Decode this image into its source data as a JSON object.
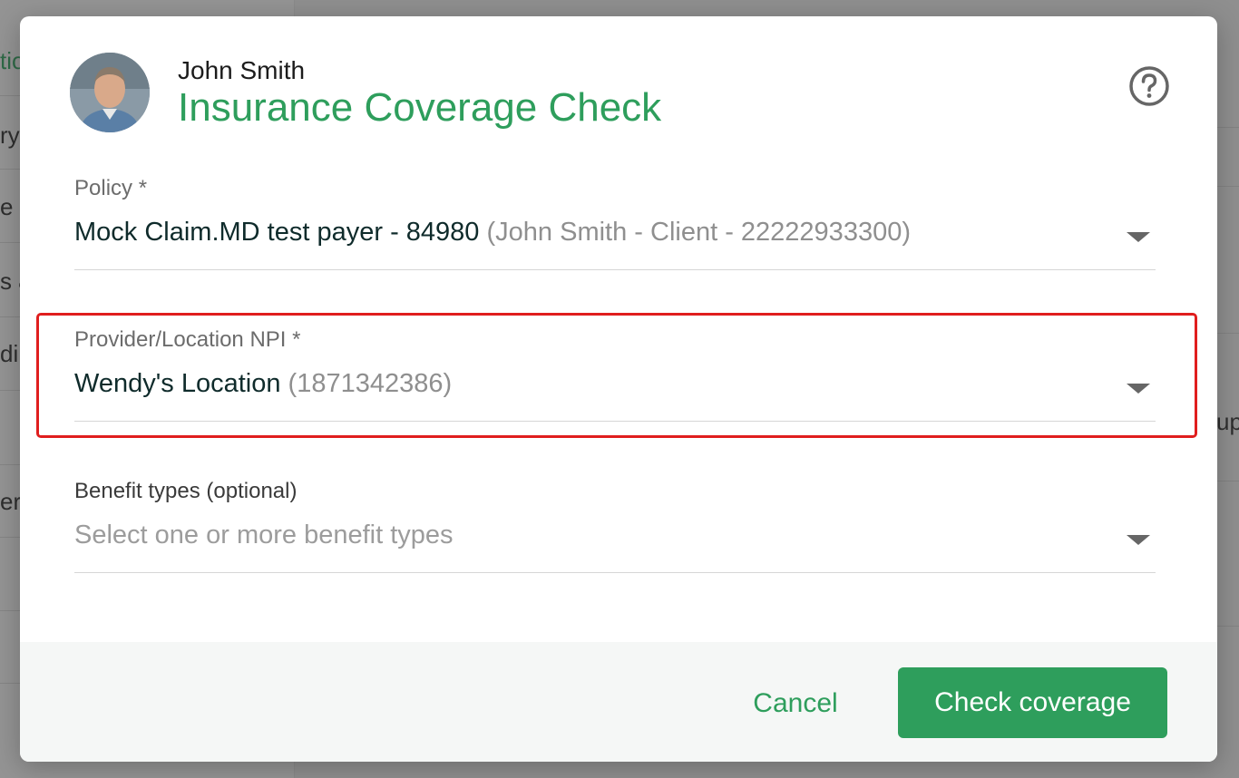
{
  "background": {
    "sidebar_fragments": [
      "tio",
      "ry",
      "e",
      "s &",
      "di",
      "er"
    ],
    "right_fragment": "up"
  },
  "header": {
    "patient_name": "John Smith",
    "title": "Insurance Coverage Check",
    "avatar_icon": "user-avatar-photo",
    "help_icon": "question-circle-icon"
  },
  "fields": {
    "policy": {
      "label": "Policy *",
      "value_main": "Mock Claim.MD test payer - 84980",
      "value_detail": "(John Smith - Client - 22222933300)"
    },
    "provider": {
      "label": "Provider/Location NPI *",
      "value_main": "Wendy's Location",
      "value_detail": "(1871342386)"
    },
    "benefits": {
      "label": "Benefit types (optional)",
      "placeholder": "Select one or more benefit types"
    }
  },
  "footer": {
    "cancel_label": "Cancel",
    "submit_label": "Check coverage"
  },
  "colors": {
    "accent": "#2e9e5c",
    "highlight": "#e01e1e",
    "text_dark": "#0f2b2b",
    "text_muted": "#8f8f8f"
  }
}
